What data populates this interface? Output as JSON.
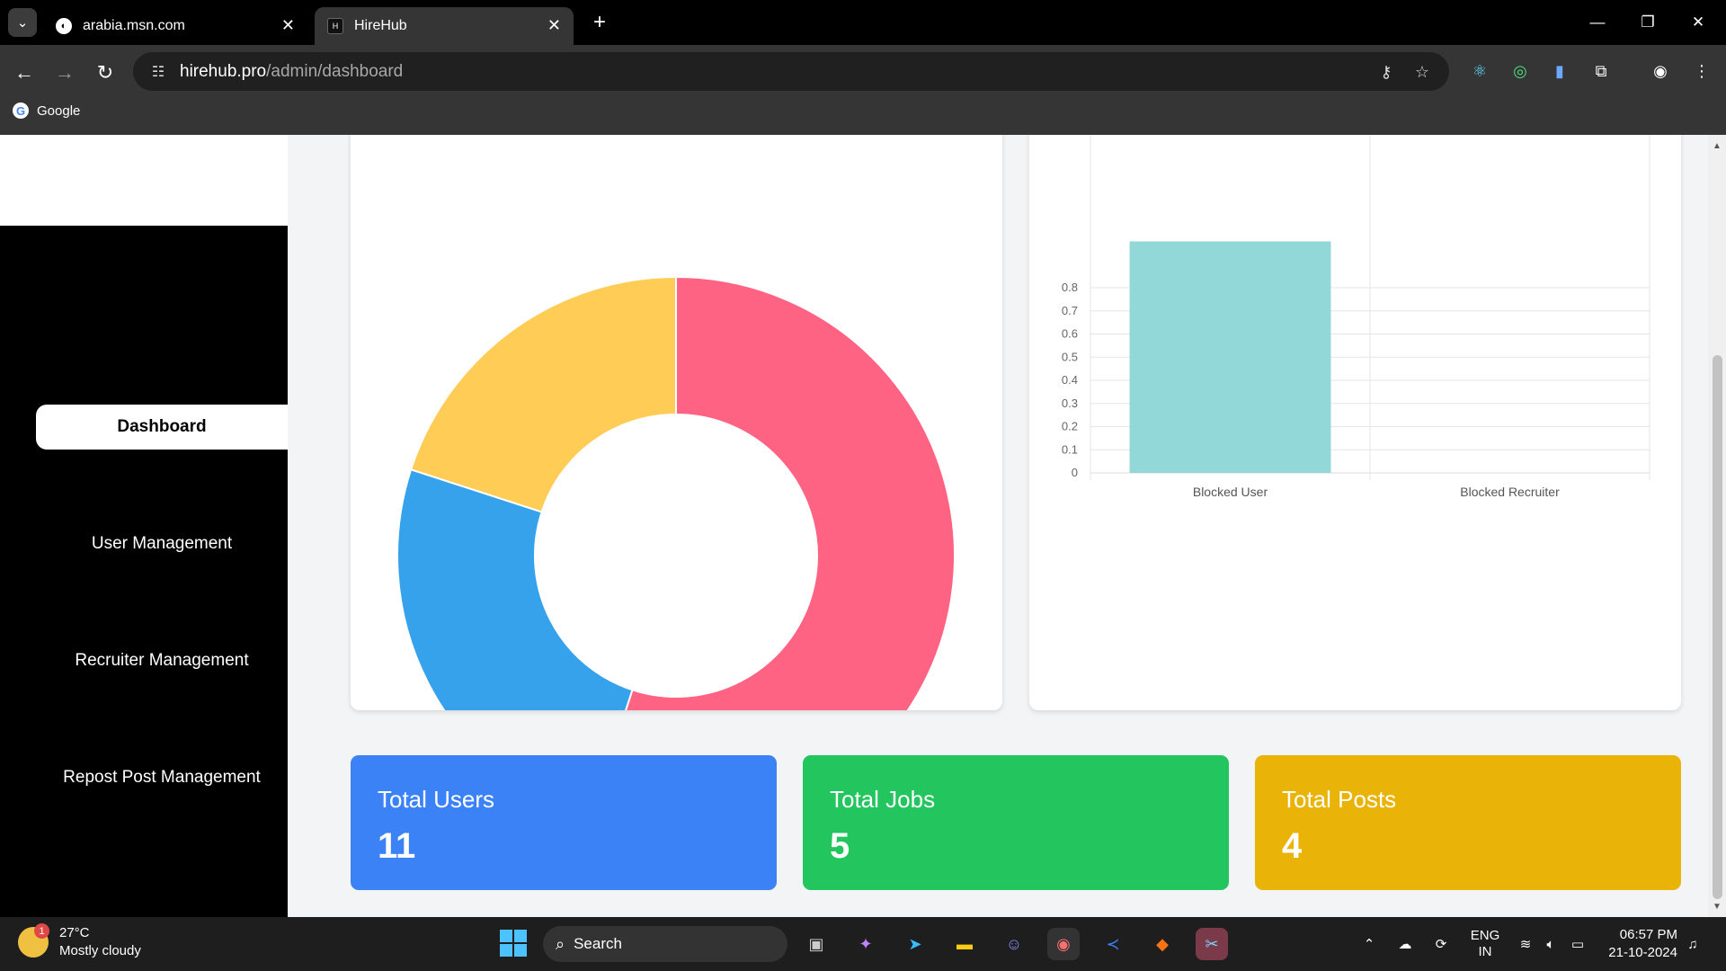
{
  "browser": {
    "tabs": [
      {
        "title": "arabia.msn.com",
        "active": false
      },
      {
        "title": "HireHub",
        "active": true
      }
    ],
    "url_domain": "hirehub.pro",
    "url_path": "/admin/dashboard",
    "bookmark": "Google"
  },
  "sidebar": {
    "items": [
      {
        "label": "Dashboard",
        "active": true
      },
      {
        "label": "User Management",
        "active": false
      },
      {
        "label": "Recruiter Management",
        "active": false
      },
      {
        "label": "Repost Post Management",
        "active": false
      }
    ]
  },
  "chart_data": [
    {
      "type": "pie",
      "variant": "doughnut",
      "values": [
        11,
        5,
        4
      ],
      "colors": [
        "#ff6384",
        "#36a2eb",
        "#ffcd56"
      ],
      "title": ""
    },
    {
      "type": "bar",
      "categories": [
        "Blocked User",
        "Blocked Recruiter"
      ],
      "values": [
        1,
        0
      ],
      "colors": [
        "#93d8d8"
      ],
      "ylim": [
        0,
        0.8
      ],
      "yticks": [
        "0",
        "0.1",
        "0.2",
        "0.3",
        "0.4",
        "0.5",
        "0.6",
        "0.7",
        "0.8"
      ],
      "grid": true,
      "title": ""
    }
  ],
  "stats": [
    {
      "label": "Total Users",
      "value": "11",
      "color": "#3b82f6"
    },
    {
      "label": "Total Jobs",
      "value": "5",
      "color": "#22c55e"
    },
    {
      "label": "Total Posts",
      "value": "4",
      "color": "#eab308"
    }
  ],
  "taskbar": {
    "weather_temp": "27°C",
    "weather_desc": "Mostly cloudy",
    "weather_badge": "1",
    "search_label": "Search",
    "lang_top": "ENG",
    "lang_bottom": "IN",
    "time": "06:57 PM",
    "date": "21-10-2024"
  }
}
